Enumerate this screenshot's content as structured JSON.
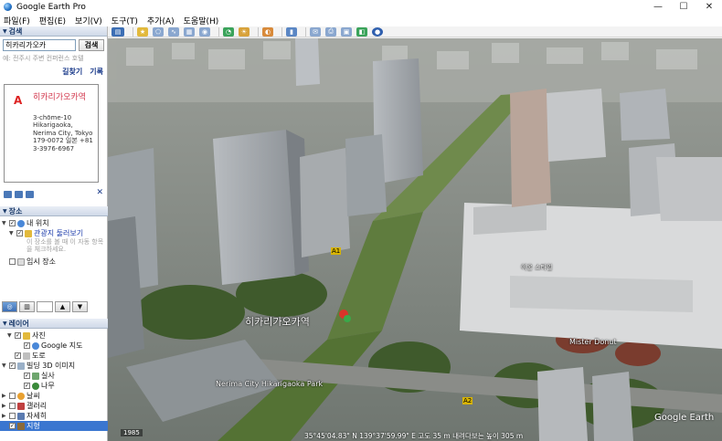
{
  "window": {
    "title": "Google Earth Pro",
    "minimize": "—",
    "maximize": "☐",
    "close": "✕"
  },
  "menu": [
    "파일(F)",
    "편집(E)",
    "보기(V)",
    "도구(T)",
    "추가(A)",
    "도움말(H)"
  ],
  "search": {
    "header": "검색",
    "value": "히카리가오카",
    "button": "검색",
    "hint": "예: 전주시 주변 컨퍼런스 호텔",
    "directions": "길찾기",
    "history": "기록",
    "result": {
      "marker": "A",
      "title": "히카리가오카역",
      "address": "3-chōme-10 Hikarigaoka, Nerima City, Tokyo 179-0072 일본 +81 3-3976-6967"
    }
  },
  "places": {
    "header": "장소",
    "my_places": "내 위치",
    "tour": "관광지 둘러보기",
    "tour_sub": "이 장소를 볼 때 이 자동 항목을 체크하세요.",
    "temp": "임시 장소"
  },
  "layers": {
    "header": "레이어",
    "items": [
      {
        "label": "사진",
        "checked": true
      },
      {
        "label": "Google 지도",
        "checked": true
      },
      {
        "label": "도로",
        "checked": true
      },
      {
        "label": "빌딩 3D 이미지",
        "checked": true
      },
      {
        "label": "실사",
        "checked": true
      },
      {
        "label": "나무",
        "checked": true
      },
      {
        "label": "날씨",
        "checked": false
      },
      {
        "label": "갤러리",
        "checked": false
      },
      {
        "label": "자세히",
        "checked": false
      },
      {
        "label": "지형",
        "checked": true
      }
    ]
  },
  "map": {
    "station_label": "히카리가오카역",
    "road_label": "Nerima City Hikarigaoka Park",
    "donut_label": "Mister Donut",
    "bus_label": "이온 스타일",
    "route_a1": "A1",
    "route_a2": "A2",
    "scale": "1985",
    "status": "35°45'04.83\" N 139°37'59.99\" E 고도 35 m  내려다보는 높이 305 m",
    "brand": "Google Earth"
  },
  "colors": {
    "accent": "#3a76d0",
    "header": "#1a3a6a",
    "result_title": "#d2344a"
  }
}
